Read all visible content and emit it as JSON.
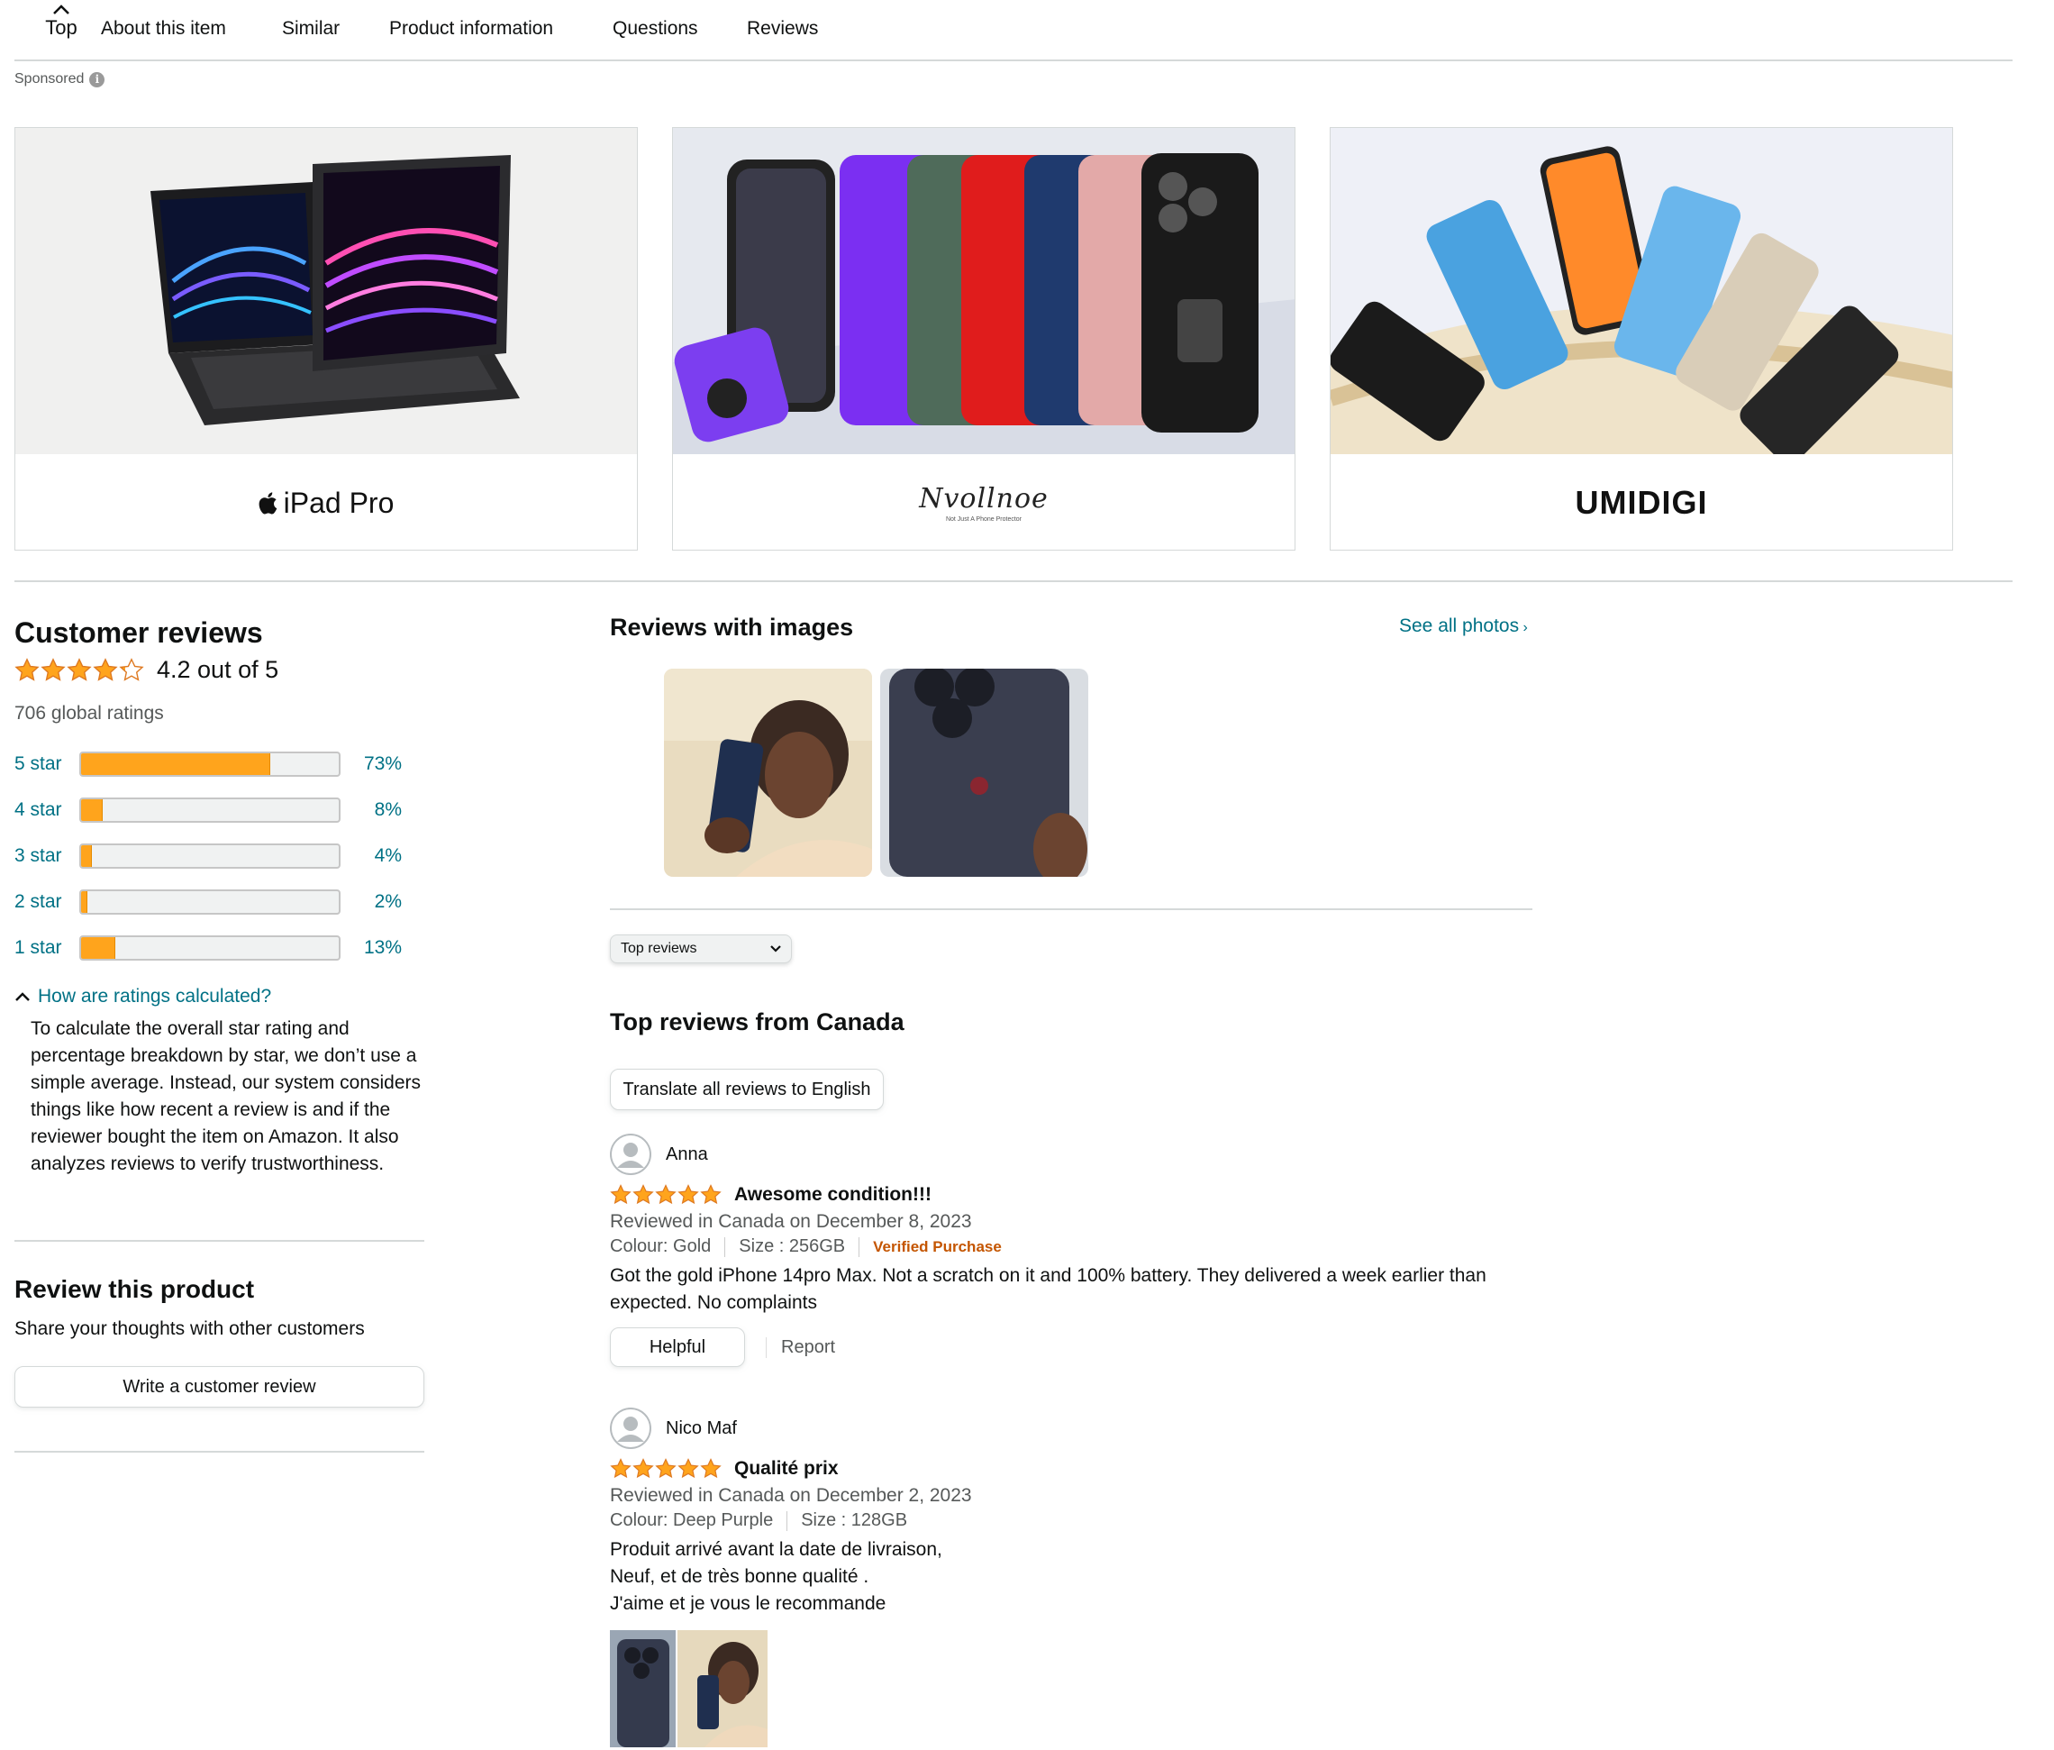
{
  "nav": {
    "top_label": "Top",
    "items": [
      "About this item",
      "Similar",
      "Product information",
      "Questions",
      "Reviews"
    ]
  },
  "sponsored_label": "Sponsored",
  "sponsored_cards": [
    {
      "brand": "iPad Pro",
      "icon": "apple-logo-icon"
    },
    {
      "brand": "Nvollnoe",
      "tagline": "Not Just A Phone Protector"
    },
    {
      "brand": "UMIDIGI"
    }
  ],
  "customer_reviews": {
    "title": "Customer reviews",
    "rating_text": "4.2 out of 5",
    "rating": 4.2,
    "global_ratings": "706 global ratings",
    "histogram": [
      {
        "label": "5 star",
        "pct": "73%",
        "value": 73
      },
      {
        "label": "4 star",
        "pct": "8%",
        "value": 8
      },
      {
        "label": "3 star",
        "pct": "4%",
        "value": 4
      },
      {
        "label": "2 star",
        "pct": "2%",
        "value": 2
      },
      {
        "label": "1 star",
        "pct": "13%",
        "value": 13
      }
    ],
    "how_calculated_label": "How are ratings calculated?",
    "how_calculated_text": "To calculate the overall star rating and percentage breakdown by star, we don’t use a simple average. Instead, our system considers things like how recent a review is and if the reviewer bought the item on Amazon. It also analyzes reviews to verify trustworthiness."
  },
  "review_product": {
    "title": "Review this product",
    "subtitle": "Share your thoughts with other customers",
    "button": "Write a customer review"
  },
  "reviews_with_images": {
    "title": "Reviews with images",
    "see_all": "See all photos"
  },
  "sort": {
    "selected": "Top reviews"
  },
  "top_reviews": {
    "title": "Top reviews from Canada",
    "translate_button": "Translate all reviews to English",
    "reviews": [
      {
        "name": "Anna",
        "stars": 5,
        "title": "Awesome condition!!!",
        "date": "Reviewed in Canada on December 8, 2023",
        "colour": "Colour: Gold",
        "size": "Size : 256GB",
        "verified": "Verified Purchase",
        "body": "Got the gold iPhone 14pro Max. Not a scratch on it and 100% battery. They delivered a week earlier than expected. No complaints",
        "helpful": "Helpful",
        "report": "Report"
      },
      {
        "name": "Nico Maf",
        "stars": 5,
        "title": "Qualité prix",
        "date": "Reviewed in Canada on December 2, 2023",
        "colour": "Colour: Deep Purple",
        "size": "Size : 128GB",
        "body_lines": [
          "Produit arrivé avant la date de livraison,",
          "Neuf, et de très bonne qualité .",
          "J'aime et je vous le recommande"
        ]
      }
    ]
  },
  "colors": {
    "link": "#007185",
    "star": "#ffa41c",
    "verified": "#c45500",
    "muted": "#565959"
  }
}
